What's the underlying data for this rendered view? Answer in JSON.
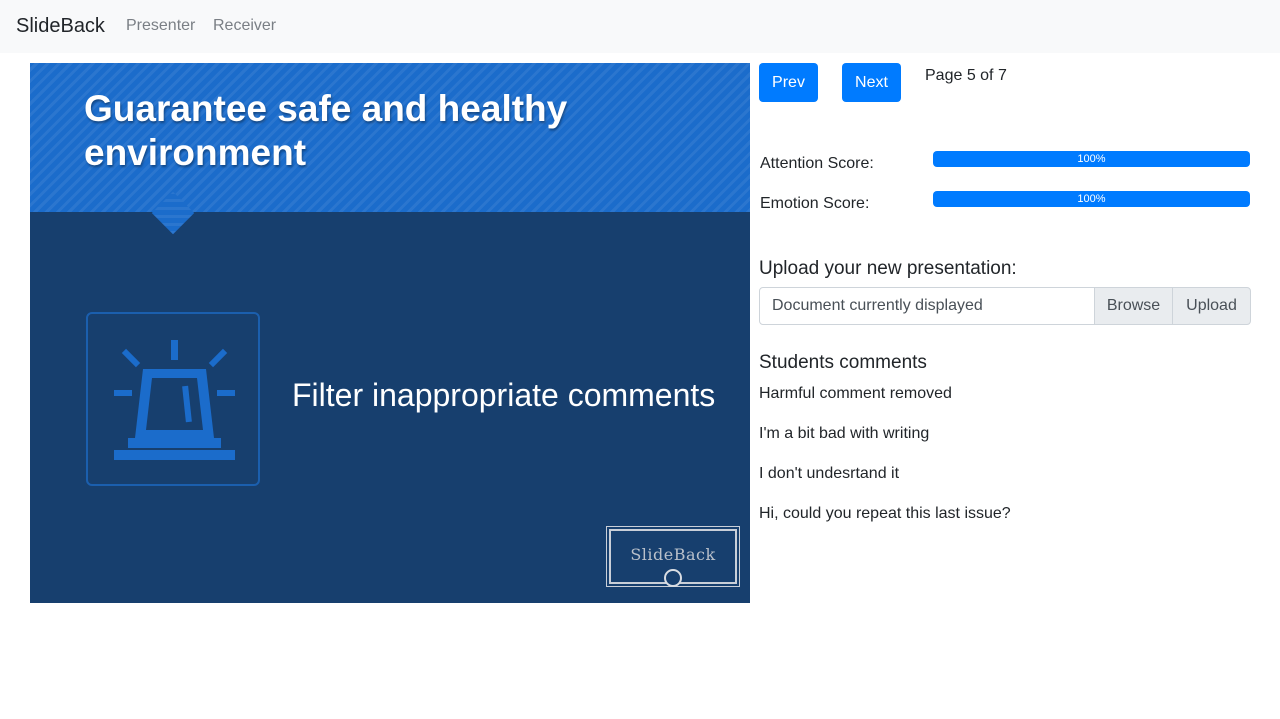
{
  "navbar": {
    "brand": "SlideBack",
    "links": [
      "Presenter",
      "Receiver"
    ]
  },
  "slide": {
    "title": "Guarantee safe and healthy environment",
    "subtitle": "Filter inappropriate comments",
    "icon": "siren-icon",
    "logo_text": "SlideBack",
    "colors": {
      "header": "#1b6ccb",
      "body": "#173f6e",
      "icon": "#1b6ccb"
    }
  },
  "controls": {
    "prev_label": "Prev",
    "next_label": "Next",
    "page_info": "Page 5 of 7"
  },
  "scores": {
    "attention_label": "Attention Score:",
    "attention_value": 100,
    "attention_text": "100%",
    "emotion_label": "Emotion Score:",
    "emotion_value": 100,
    "emotion_text": "100%"
  },
  "upload": {
    "heading": "Upload your new presentation:",
    "placeholder": "Document currently displayed",
    "browse_label": "Browse",
    "upload_label": "Upload"
  },
  "comments": {
    "heading": "Students comments",
    "items": [
      "Harmful comment removed",
      "I'm a bit bad with writing",
      "I don't undesrtand it",
      "Hi, could you repeat this last issue?"
    ]
  },
  "theme": {
    "primary": "#007bff",
    "navbar_bg": "#f8f9fa"
  }
}
